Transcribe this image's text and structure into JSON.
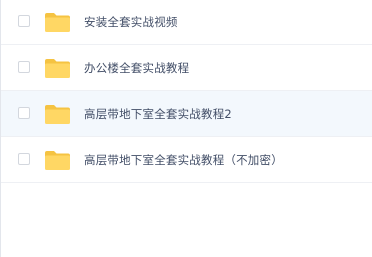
{
  "colors": {
    "folder_body": "#ffd764",
    "folder_tab": "#f5c342",
    "row_hover_bg": "#f3f8fd",
    "text": "#424e67"
  },
  "files": [
    {
      "name": "安装全套实战视频",
      "icon": "folder-icon",
      "hovered": false
    },
    {
      "name": "办公楼全套实战教程",
      "icon": "folder-icon",
      "hovered": false
    },
    {
      "name": "高层带地下室全套实战教程2",
      "icon": "folder-icon",
      "hovered": true
    },
    {
      "name": "高层带地下室全套实战教程（不加密）",
      "icon": "folder-icon",
      "hovered": false
    }
  ]
}
